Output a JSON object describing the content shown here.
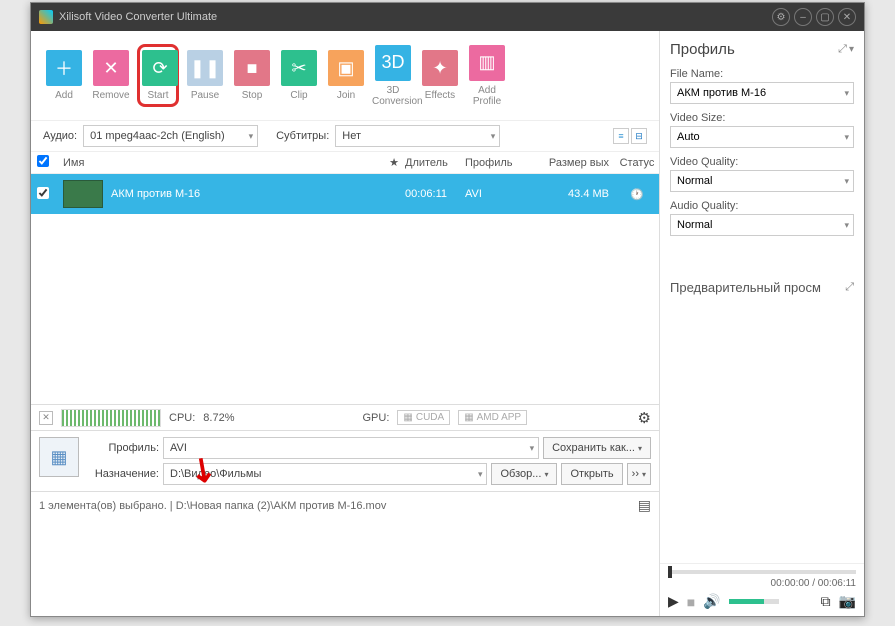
{
  "title": "Xilisoft Video Converter Ultimate",
  "toolbar": {
    "add": "Add",
    "remove": "Remove",
    "start": "Start",
    "pause": "Pause",
    "stop": "Stop",
    "clip": "Clip",
    "join": "Join",
    "threeD": "3D Conversion",
    "effects": "Effects",
    "addProfile": "Add Profile"
  },
  "opts": {
    "audioLabel": "Аудио:",
    "audioValue": "01 mpeg4aac-2ch (English)",
    "subsLabel": "Субтитры:",
    "subsValue": "Нет"
  },
  "columns": {
    "name": "Имя",
    "duration": "Длитель",
    "profile": "Профиль",
    "size": "Размер вых",
    "status": "Статус"
  },
  "row": {
    "name": "АКМ против М-16",
    "duration": "00:06:11",
    "profile": "AVI",
    "size": "43.4 MB"
  },
  "perf": {
    "cpuLabel": "CPU:",
    "cpuValue": "8.72%",
    "gpuLabel": "GPU:",
    "cuda": "CUDA",
    "amd": "AMD APP"
  },
  "dest": {
    "profileLabel": "Профиль:",
    "profileValue": "AVI",
    "saveAs": "Сохранить как...",
    "destLabel": "Назначение:",
    "destValue": "D:\\Видео\\Фильмы",
    "browse": "Обзор...",
    "open": "Открыть"
  },
  "status": "1 элемента(ов) выбрано. | D:\\Новая папка (2)\\АКМ против М-16.mov",
  "rightPanel": {
    "profileTitle": "Профиль",
    "fileNameLabel": "File Name:",
    "fileNameValue": "АКМ против М-16",
    "videoSizeLabel": "Video Size:",
    "videoSizeValue": "Auto",
    "videoQualityLabel": "Video Quality:",
    "videoQualityValue": "Normal",
    "audioQualityLabel": "Audio Quality:",
    "audioQualityValue": "Normal",
    "previewTitle": "Предварительный просм",
    "time": "00:00:00 / 00:06:11"
  }
}
